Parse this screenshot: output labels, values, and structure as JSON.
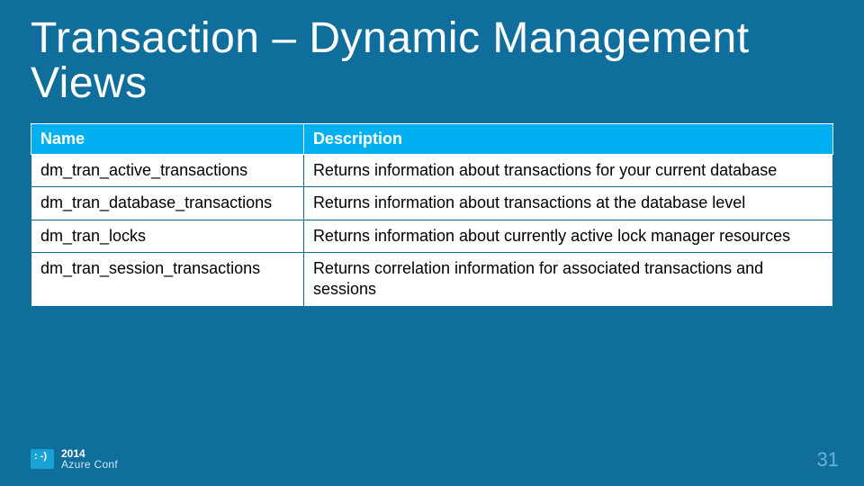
{
  "title": "Transaction – Dynamic Management Views",
  "table": {
    "headers": {
      "col0": "Name",
      "col1": "Description"
    },
    "rows": [
      {
        "name": "dm_tran_active_transactions",
        "desc": "Returns information about transactions for your current database"
      },
      {
        "name": "dm_tran_database_transactions",
        "desc": "Returns information about transactions at the database level"
      },
      {
        "name": "dm_tran_locks",
        "desc": "Returns information about currently active lock manager resources"
      },
      {
        "name": "dm_tran_session_transactions",
        "desc": "Returns correlation information for associated transactions and sessions"
      }
    ]
  },
  "footer": {
    "year": "2014",
    "conf": "Azure Conf"
  },
  "page_number": "31"
}
